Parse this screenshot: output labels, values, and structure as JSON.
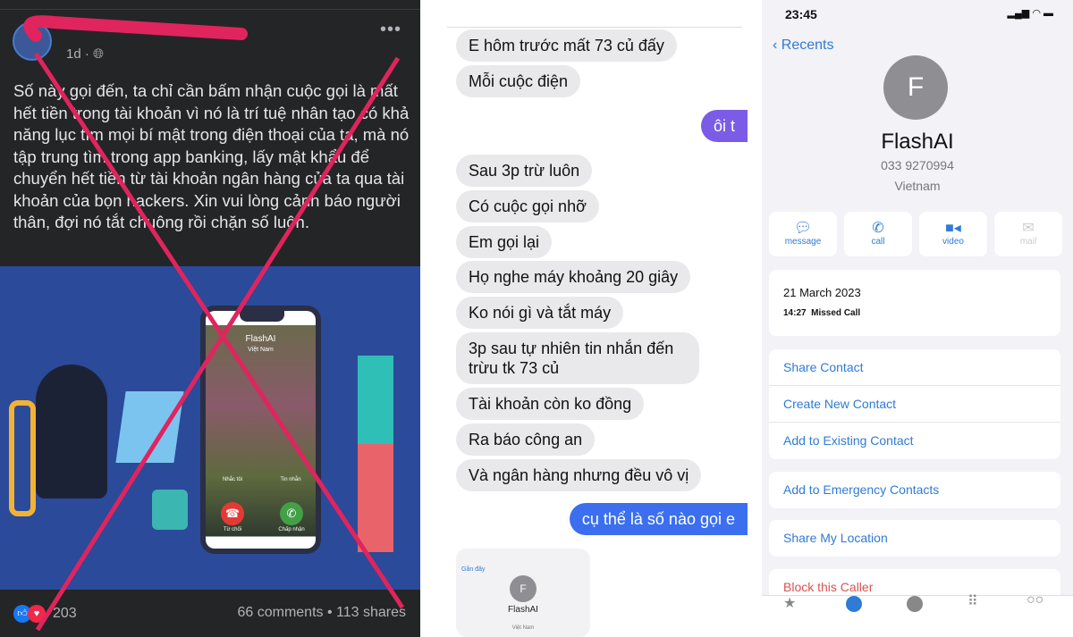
{
  "facebook_post": {
    "timestamp": "1d ·",
    "more_label": "•••",
    "text": "Số này gọi đến, ta chỉ cần bấm nhận cuộc gọi là mất hết tiền trong tài khoản vì nó là trí tuệ nhân tạo có khả năng lục tìm mọi bí mật trong điện thoại của ta, mà nó tập trung tìm trong app banking, lấy mật khẩu để chuyển hết tiền từ tài khoản ngân hàng của ta qua tài khoản của bọn hackers. Xin vui lòng cảnh báo người thân, đợi nó tắt chuông rồi chặn số luôn.",
    "illustration": {
      "caller_name": "FlashAI",
      "caller_country": "Việt Nam",
      "remind_label": "Nhắc tôi",
      "message_label": "Tin nhắn",
      "decline_label": "Từ chối",
      "accept_label": "Chấp nhận",
      "decline_color": "#e53935",
      "accept_color": "#43a047"
    },
    "reaction_count": "203",
    "stats": "66 comments • 113 shares",
    "overlay_color": "#e0245e"
  },
  "chat": {
    "messages": [
      {
        "text": "E hôm trước mất 73 củ đấy",
        "side": "received"
      },
      {
        "text": "Mỗi cuộc điện",
        "side": "received"
      },
      {
        "text": "ôi t",
        "side": "sent"
      },
      {
        "text": "Sau 3p trừ luôn",
        "side": "received"
      },
      {
        "text": "Có cuộc gọi nhỡ",
        "side": "received"
      },
      {
        "text": "Em gọi lại",
        "side": "received"
      },
      {
        "text": "Họ nghe máy khoảng 20 giây",
        "side": "received"
      },
      {
        "text": "Ko nói gì và tắt máy",
        "side": "received"
      },
      {
        "text": "3p sau tự nhiên tin nhắn đến trừu tk 73 củ",
        "side": "received"
      },
      {
        "text": "Tài khoản còn ko đồng",
        "side": "received"
      },
      {
        "text": "Ra báo công an",
        "side": "received"
      },
      {
        "text": "Và ngân hàng nhưng đều vô vị",
        "side": "received"
      },
      {
        "text": "cụ thể là số nào gọi e",
        "side": "sent"
      }
    ],
    "thumbnail": {
      "back": "Gần đây",
      "name": "FlashAI",
      "country": "Việt Nam"
    }
  },
  "contact": {
    "time": "23:45",
    "status_icons": "signal wifi battery",
    "back_label": "Recents",
    "initial": "F",
    "name": "FlashAI",
    "number": "033 9270994",
    "country": "Vietnam",
    "actions": [
      {
        "label": "message",
        "icon": "message-icon"
      },
      {
        "label": "call",
        "icon": "phone-icon"
      },
      {
        "label": "video",
        "icon": "video-icon"
      },
      {
        "label": "mail",
        "icon": "mail-icon"
      }
    ],
    "call_date": "21 March 2023",
    "call_time": "14:27",
    "call_type": "Missed Call",
    "options1": [
      "Share Contact",
      "Create New Contact",
      "Add to Existing Contact"
    ],
    "options2": [
      "Add to Emergency Contacts"
    ],
    "options3": [
      "Share My Location"
    ],
    "block_label": "Block this Caller",
    "accent": "#2f7bd6"
  }
}
